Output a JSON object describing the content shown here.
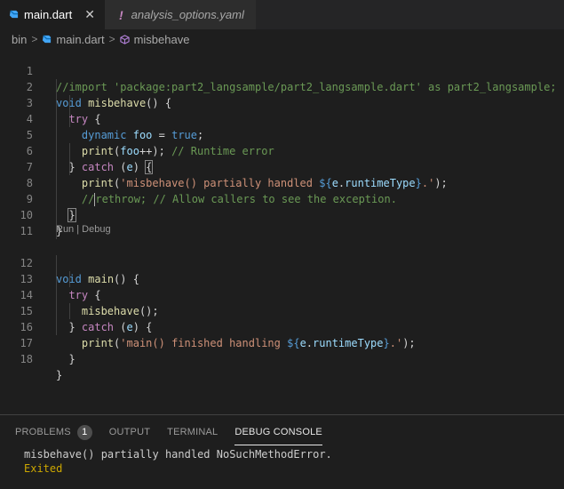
{
  "tabs": [
    {
      "label": "main.dart",
      "active": true,
      "icon": "dart-icon"
    },
    {
      "label": "analysis_options.yaml",
      "active": false,
      "icon": "warning-exclamation-icon"
    }
  ],
  "breadcrumb": {
    "folder": "bin",
    "file": "main.dart",
    "symbol": "misbehave"
  },
  "code_lens": {
    "run": "Run",
    "separator": "|",
    "debug": "Debug"
  },
  "code_lines": [
    {
      "n": "1",
      "text": "//import 'package:part2_langsample/part2_langsample.dart' as part2_langsample;"
    },
    {
      "n": "2",
      "text": "void misbehave() {"
    },
    {
      "n": "3",
      "text": "  try {"
    },
    {
      "n": "4",
      "text": "    dynamic foo = true;"
    },
    {
      "n": "5",
      "text": "    print(foo++); // Runtime error"
    },
    {
      "n": "6",
      "text": "  } catch (e) {"
    },
    {
      "n": "7",
      "text": "    print('misbehave() partially handled ${e.runtimeType}.');"
    },
    {
      "n": "8",
      "text": "    //rethrow; // Allow callers to see the exception."
    },
    {
      "n": "9",
      "text": "  }"
    },
    {
      "n": "10",
      "text": "}"
    },
    {
      "n": "11",
      "text": ""
    },
    {
      "n": "12",
      "text": "void main() {"
    },
    {
      "n": "13",
      "text": "  try {"
    },
    {
      "n": "14",
      "text": "    misbehave();"
    },
    {
      "n": "15",
      "text": "  } catch (e) {"
    },
    {
      "n": "16",
      "text": "    print('main() finished handling ${e.runtimeType}.');"
    },
    {
      "n": "17",
      "text": "  }"
    },
    {
      "n": "18",
      "text": "}"
    }
  ],
  "panel": {
    "tabs": [
      {
        "label": "PROBLEMS",
        "badge": "1",
        "active": false
      },
      {
        "label": "OUTPUT",
        "active": false
      },
      {
        "label": "TERMINAL",
        "active": false
      },
      {
        "label": "DEBUG CONSOLE",
        "active": true
      }
    ],
    "console_lines": [
      "misbehave() partially handled NoSuchMethodError.",
      "Exited"
    ]
  },
  "colors": {
    "background": "#1e1e1e",
    "comment": "#6a9955",
    "keyword": "#569cd6",
    "control": "#c586c0",
    "function": "#dcdcaa",
    "string": "#ce9178",
    "variable": "#9cdcfe",
    "exited": "#cca700"
  }
}
